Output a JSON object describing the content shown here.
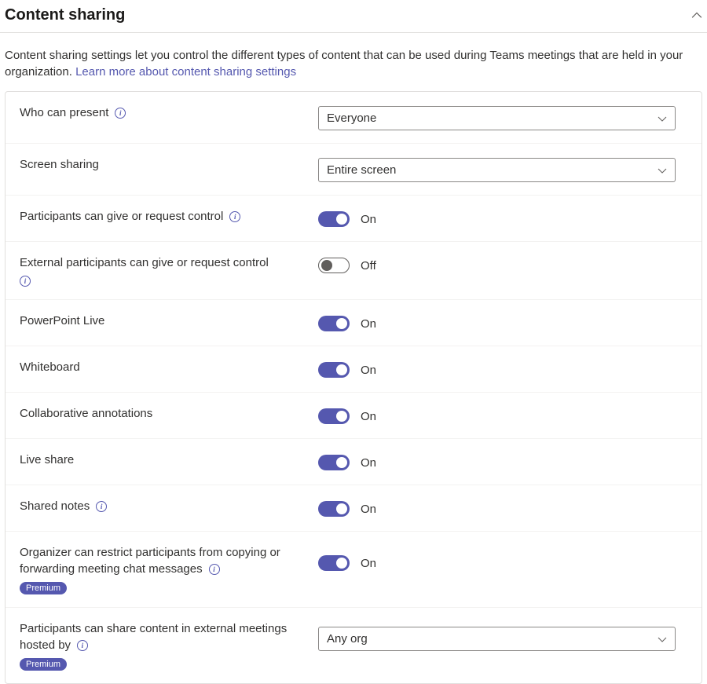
{
  "section": {
    "title": "Content sharing",
    "description_text": "Content sharing settings let you control the different types of content that can be used during Teams meetings that are held in your organization. ",
    "description_link": "Learn more about content sharing settings"
  },
  "toggle_labels": {
    "on": "On",
    "off": "Off"
  },
  "badges": {
    "premium": "Premium"
  },
  "settings": {
    "who_can_present": {
      "label": "Who can present",
      "value": "Everyone"
    },
    "screen_sharing": {
      "label": "Screen sharing",
      "value": "Entire screen"
    },
    "participants_control": {
      "label": "Participants can give or request control"
    },
    "external_control": {
      "label": "External participants can give or request control"
    },
    "powerpoint_live": {
      "label": "PowerPoint Live"
    },
    "whiteboard": {
      "label": "Whiteboard"
    },
    "collab_annotations": {
      "label": "Collaborative annotations"
    },
    "live_share": {
      "label": "Live share"
    },
    "shared_notes": {
      "label": "Shared notes"
    },
    "restrict_copy": {
      "label": "Organizer can restrict participants from copying or forwarding meeting chat messages"
    },
    "share_external": {
      "label": "Participants can share content in external meetings hosted by",
      "value": "Any org"
    }
  }
}
